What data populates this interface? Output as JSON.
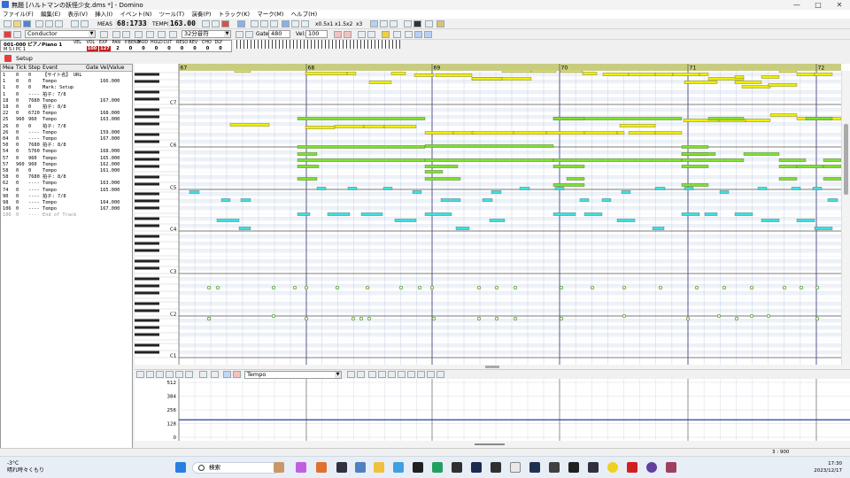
{
  "window": {
    "title": "無題 [ハルトマンの妖怪少女.dms *] - Domino",
    "minimize": "—",
    "maximize": "□",
    "close": "✕"
  },
  "menu": [
    "ファイル(F)",
    "編集(E)",
    "表示(V)",
    "挿入(I)",
    "イベント(N)",
    "ツール(T)",
    "演奏(P)",
    "トラック(K)",
    "マーク(M)",
    "ヘルプ(H)"
  ],
  "toolbar1": {
    "meas_label": "MEAS",
    "position": "68:1733",
    "tempo_label": "TEMPO",
    "tempo": "163.00",
    "speed_buttons": [
      "x0.5",
      "x1",
      "x1.5",
      "x2",
      "x3"
    ]
  },
  "toolbar2": {
    "conductor": "Conductor",
    "note_length": "32分音符",
    "gate_label": "Gate:",
    "gate": "480",
    "vel_label": "Vel:",
    "vel": "100"
  },
  "track_header": {
    "name": "001-000 ピアノPiano 1",
    "columns": [
      "VEL",
      "VOL",
      "EXP",
      "PAN",
      "P.BEND",
      "MOD",
      "HOLD",
      "CUT",
      "RESO",
      "REV",
      "CHO",
      "DLY"
    ],
    "values": [
      "",
      "100",
      "127",
      "2",
      "0",
      "0",
      "0",
      "0",
      "0",
      "0",
      "0",
      "0"
    ],
    "row2": "M  S  I  PC 1"
  },
  "setup_tab": "Setup",
  "event_list": {
    "columns": [
      "Mea",
      "Tick",
      "Step",
      "Event",
      "Gate",
      "Vel/Value"
    ],
    "rows": [
      {
        "mea": "1",
        "tick": "0",
        "step": "0",
        "event": "【サイト名】 URL",
        "gate": "",
        "value": ""
      },
      {
        "mea": "1",
        "tick": "0",
        "step": "0",
        "event": "Tempo",
        "gate": "",
        "value": "166.000"
      },
      {
        "mea": "1",
        "tick": "0",
        "step": "0",
        "event": "Mark: Setup",
        "gate": "",
        "value": ""
      },
      {
        "mea": "1",
        "tick": "0",
        "step": "----",
        "event": "拍子: 7/8",
        "gate": "",
        "value": ""
      },
      {
        "mea": "18",
        "tick": "0",
        "step": "7680",
        "event": "Tempo",
        "gate": "",
        "value": "167.000"
      },
      {
        "mea": "18",
        "tick": "0",
        "step": "0",
        "event": "拍子: 8/8",
        "gate": "",
        "value": ""
      },
      {
        "mea": "22",
        "tick": "0",
        "step": "6720",
        "event": "Tempo",
        "gate": "",
        "value": "168.000"
      },
      {
        "mea": "25",
        "tick": "960",
        "step": "960",
        "event": "Tempo",
        "gate": "",
        "value": "163.000"
      },
      {
        "mea": "26",
        "tick": "0",
        "step": "0",
        "event": "拍子: 7/8",
        "gate": "",
        "value": ""
      },
      {
        "mea": "26",
        "tick": "0",
        "step": "----",
        "event": "Tempo",
        "gate": "",
        "value": "159.000"
      },
      {
        "mea": "04",
        "tick": "0",
        "step": "----",
        "event": "Tempo",
        "gate": "",
        "value": "167.000"
      },
      {
        "mea": "50",
        "tick": "0",
        "step": "7680",
        "event": "拍子: 8/8",
        "gate": "",
        "value": ""
      },
      {
        "mea": "54",
        "tick": "0",
        "step": "5760",
        "event": "Tempo",
        "gate": "",
        "value": "168.000"
      },
      {
        "mea": "57",
        "tick": "0",
        "step": "960",
        "event": "Tempo",
        "gate": "",
        "value": "165.000"
      },
      {
        "mea": "57",
        "tick": "960",
        "step": "960",
        "event": "Tempo",
        "gate": "",
        "value": "162.000"
      },
      {
        "mea": "58",
        "tick": "0",
        "step": "0",
        "event": "Tempo",
        "gate": "",
        "value": "161.000"
      },
      {
        "mea": "58",
        "tick": "0",
        "step": "7680",
        "event": "拍子: 8/8",
        "gate": "",
        "value": ""
      },
      {
        "mea": "62",
        "tick": "0",
        "step": "----",
        "event": "Tempo",
        "gate": "",
        "value": "163.000"
      },
      {
        "mea": "74",
        "tick": "0",
        "step": "----",
        "event": "Tempo",
        "gate": "",
        "value": "165.000"
      },
      {
        "mea": "90",
        "tick": "0",
        "step": "----",
        "event": "拍子: 7/8",
        "gate": "",
        "value": ""
      },
      {
        "mea": "98",
        "tick": "0",
        "step": "----",
        "event": "Tempo",
        "gate": "",
        "value": "164.000"
      },
      {
        "mea": "106",
        "tick": "0",
        "step": "----",
        "event": "Tempo",
        "gate": "",
        "value": "167.000"
      },
      {
        "mea": "106",
        "tick": "0",
        "step": "----",
        "event": "End of Track",
        "gate": "",
        "value": ""
      }
    ]
  },
  "ruler": {
    "measures": [
      "67",
      "68",
      "69",
      "70",
      "71",
      "72"
    ]
  },
  "octave_labels": [
    "C7",
    "C6",
    "C5",
    "C4",
    "C3",
    "C2",
    "C1"
  ],
  "controller": {
    "combo": "Tempo",
    "scale": [
      "512",
      "384",
      "256",
      "128",
      "0"
    ],
    "value": 163
  },
  "status": {
    "position": "3 : 900"
  },
  "taskbar": {
    "weather_temp": "-3°C",
    "weather_text": "晴れ時々くもり",
    "search": "検索",
    "time": "17:30",
    "date": "2023/12/17"
  },
  "colors": {
    "note_yellow": "#f0f000",
    "note_green": "#7fe030",
    "note_cyan": "#40e0e0",
    "ruler": "#c8cc80",
    "measure_line": "#5a5a8a"
  }
}
